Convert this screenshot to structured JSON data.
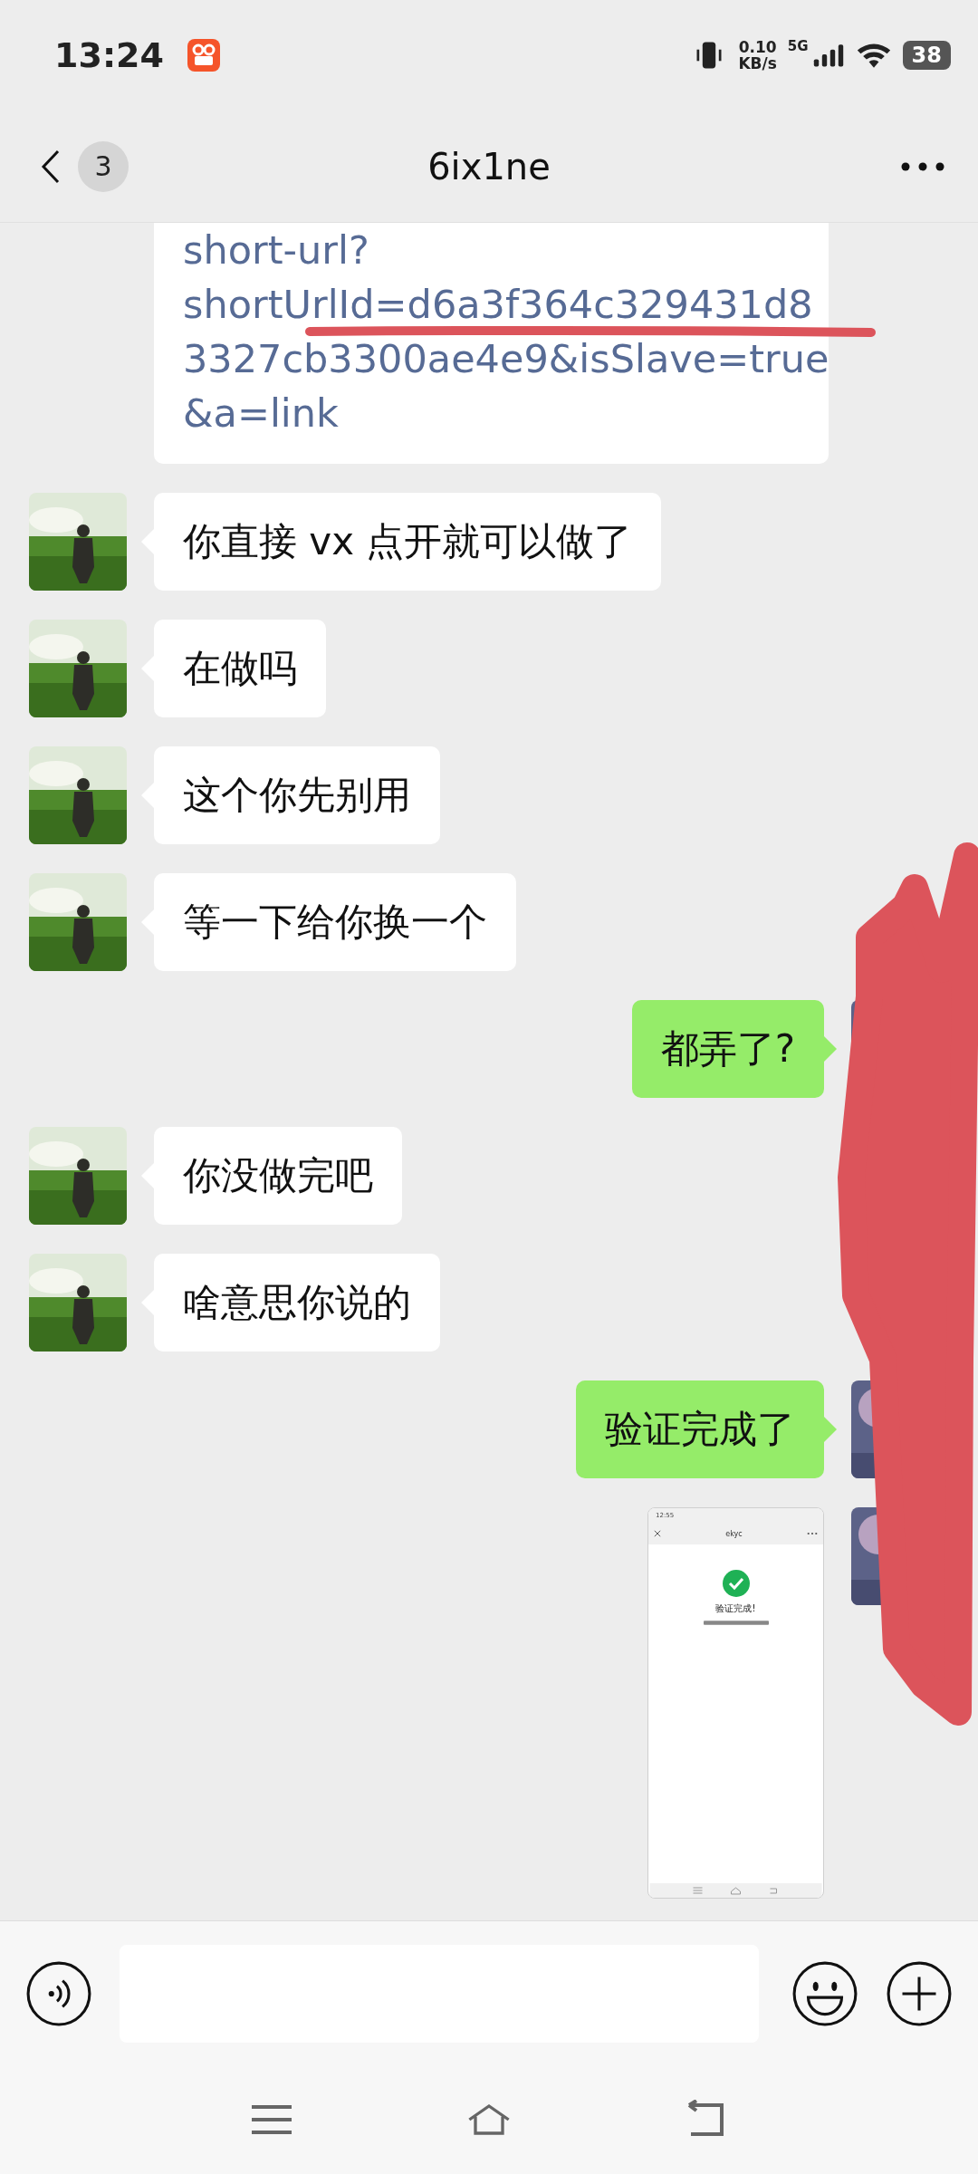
{
  "status_bar": {
    "time": "13:24",
    "net_speed_value": "0.10",
    "net_speed_unit": "KB/s",
    "network": "5G",
    "battery": "38"
  },
  "header": {
    "unread_count": "3",
    "title": "6ix1ne"
  },
  "messages": [
    {
      "kind": "link",
      "outgoing": false,
      "lines": [
        "short-url?",
        "shortUrlId=d6a3f364c329431d8",
        "3327cb3300ae4e9&isSlave=true",
        "&a=link"
      ]
    },
    {
      "kind": "text",
      "outgoing": false,
      "text": "你直接 vx 点开就可以做了"
    },
    {
      "kind": "text",
      "outgoing": false,
      "text": "在做吗"
    },
    {
      "kind": "text",
      "outgoing": false,
      "text": "这个你先别用"
    },
    {
      "kind": "text",
      "outgoing": false,
      "text": "等一下给你换一个"
    },
    {
      "kind": "text",
      "outgoing": true,
      "text": "都弄了?"
    },
    {
      "kind": "text",
      "outgoing": false,
      "text": "你没做完吧"
    },
    {
      "kind": "text",
      "outgoing": false,
      "text": "啥意思你说的"
    },
    {
      "kind": "text",
      "outgoing": true,
      "text": "验证完成了"
    },
    {
      "outgoing": true,
      "screenshot": {
        "time": "12:55",
        "title": "ekyc",
        "heading": "验证完成!"
      }
    }
  ]
}
